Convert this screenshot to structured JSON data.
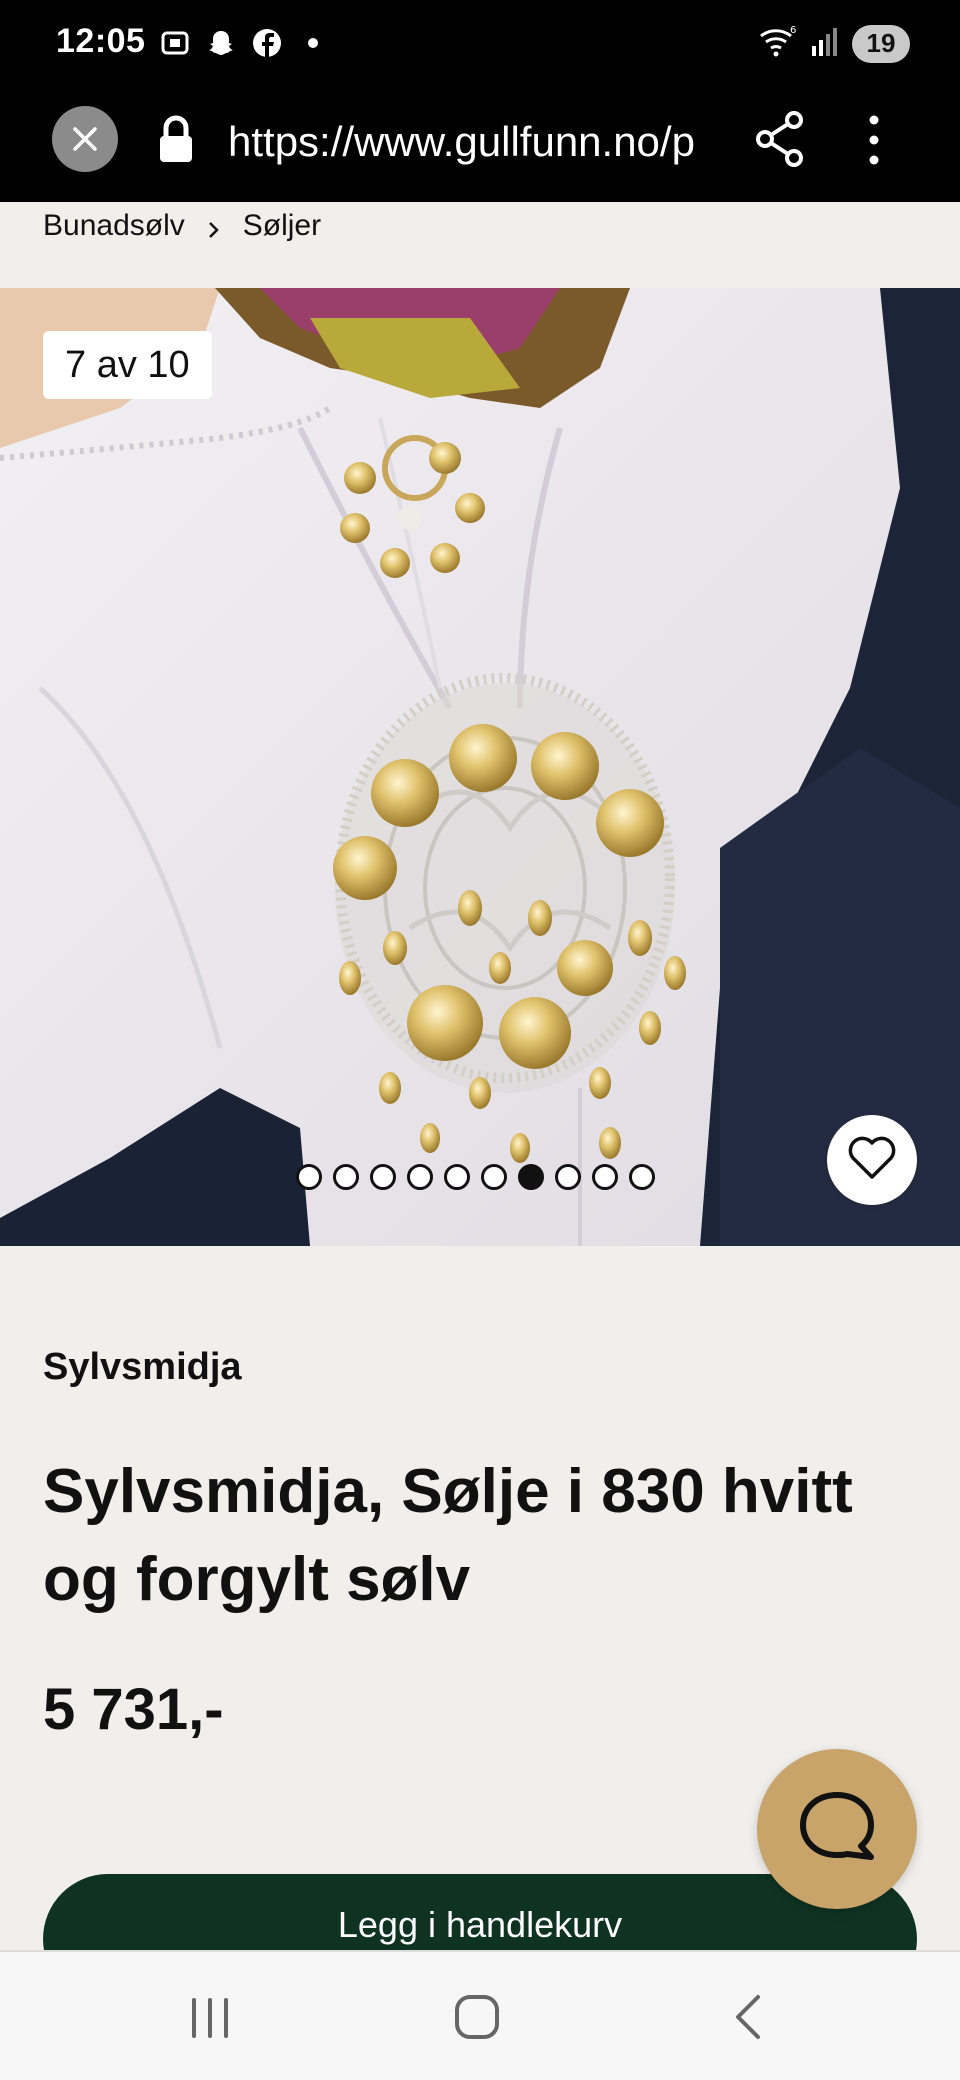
{
  "status_bar": {
    "time": "12:05",
    "battery": "19",
    "left_icons": [
      "screenshot-icon",
      "snapchat-icon",
      "facebook-icon",
      "dot-icon"
    ],
    "right_icons": [
      "wifi-icon",
      "signal-icon"
    ]
  },
  "browser": {
    "url": "https://www.gullfunn.no/p",
    "icons": [
      "close-icon",
      "lock-icon",
      "share-icon",
      "more-vert-icon"
    ]
  },
  "breadcrumb": {
    "items": [
      "Bunadsølv",
      "Søljer"
    ],
    "separator_icon": "chevron-right-icon"
  },
  "gallery": {
    "counter": "7 av 10",
    "total_images": 10,
    "active_index": 7,
    "favorite_icon": "heart-icon"
  },
  "product": {
    "brand": "Sylvsmidja",
    "title": "Sylvsmidja, Sølje i 830 hvitt og forgylt sølv",
    "price": "5 731,-"
  },
  "cart": {
    "label": "Legg i handlekurv"
  },
  "chat": {
    "icon": "chat-icon"
  },
  "nav": {
    "icons": [
      "recent-apps-icon",
      "home-icon",
      "back-icon"
    ]
  },
  "colors": {
    "cart_button": "#0f3322",
    "chat_fab": "#c8a46a",
    "page_bg": "#f1efec"
  }
}
